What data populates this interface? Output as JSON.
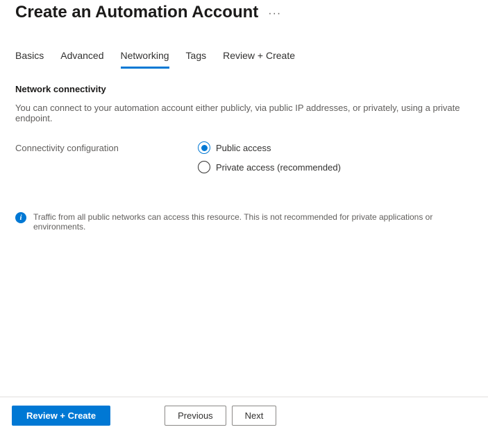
{
  "header": {
    "title": "Create an Automation Account"
  },
  "tabs": [
    {
      "label": "Basics",
      "active": false
    },
    {
      "label": "Advanced",
      "active": false
    },
    {
      "label": "Networking",
      "active": true
    },
    {
      "label": "Tags",
      "active": false
    },
    {
      "label": "Review + Create",
      "active": false
    }
  ],
  "section": {
    "heading": "Network connectivity",
    "description": "You can connect to your automation account either publicly, via public IP addresses, or privately, using a private endpoint.",
    "field_label": "Connectivity configuration",
    "options": [
      {
        "label": "Public access",
        "selected": true
      },
      {
        "label": "Private access (recommended)",
        "selected": false
      }
    ]
  },
  "info": {
    "text": "Traffic from all public networks can access this resource. This is not recommended for private applications or environments."
  },
  "footer": {
    "primary": "Review + Create",
    "previous": "Previous",
    "next": "Next"
  }
}
